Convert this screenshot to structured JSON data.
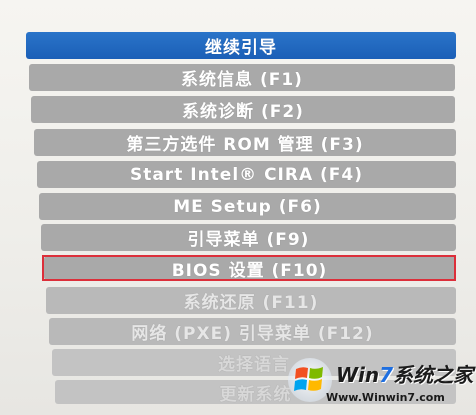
{
  "menu": {
    "items": [
      {
        "label": "继续引导",
        "state": "selected"
      },
      {
        "label": "系统信息 (F1)",
        "state": "normal"
      },
      {
        "label": "系统诊断 (F2)",
        "state": "normal"
      },
      {
        "label": "第三方选件 ROM 管理 (F3)",
        "state": "normal"
      },
      {
        "label": "Start Intel® CIRA (F4)",
        "state": "normal"
      },
      {
        "label": "ME Setup (F6)",
        "state": "normal"
      },
      {
        "label": "引导菜单 (F9)",
        "state": "normal"
      },
      {
        "label": "BIOS 设置 (F10)",
        "state": "normal",
        "annotated": true
      },
      {
        "label": "系统还原 (F11)",
        "state": "muted"
      },
      {
        "label": "网络 (PXE) 引导菜单 (F12)",
        "state": "muted"
      },
      {
        "label": "选择语言",
        "state": "faint"
      },
      {
        "label": "更新系统",
        "state": "faint"
      }
    ]
  },
  "watermark": {
    "brand_prefix": "Win",
    "brand_seven": "7",
    "brand_suffix": "系统之家",
    "url": "Www.Winwin7.com"
  },
  "colors": {
    "selected": "#1b5fb7",
    "item_gray": "#a9a9a9",
    "highlight": "#dc2f3a",
    "background": "#f2f1ed"
  }
}
